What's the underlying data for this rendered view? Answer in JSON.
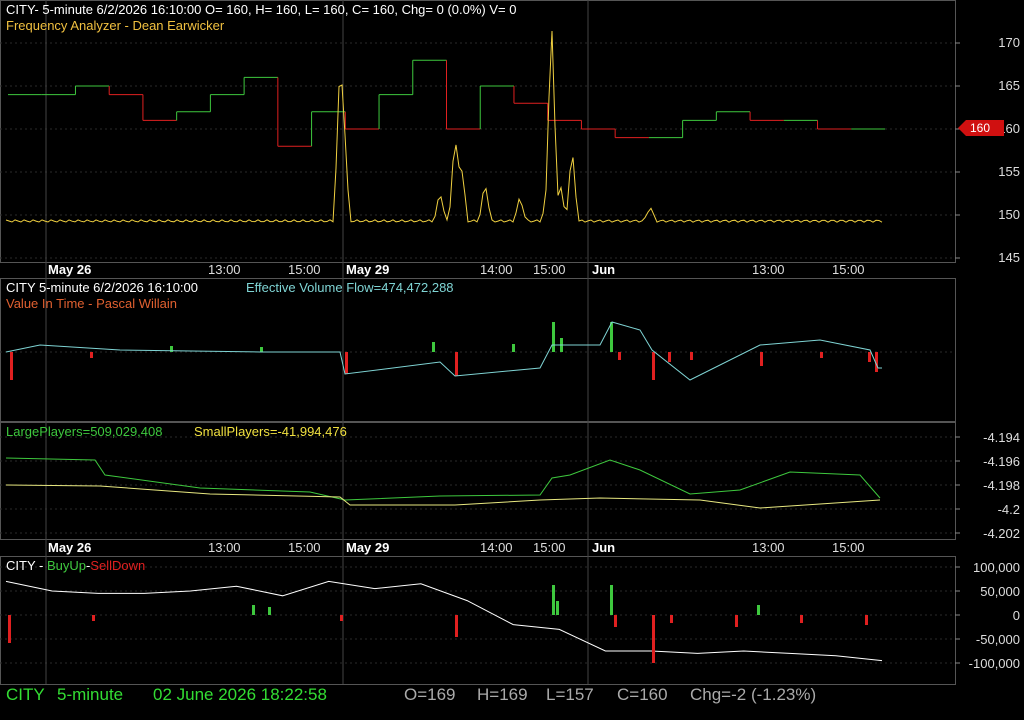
{
  "panel1": {
    "header": "CITY- 5-minute 6/2/2026 16:10:00 O= 160, H= 160, L= 160, C= 160, Chg= 0 (0.0%) V= 0",
    "subtitle": "Frequency Analyzer - Dean Earwicker",
    "yticks": [
      "170",
      "165",
      "160",
      "155",
      "150",
      "145"
    ],
    "price_tag": "160"
  },
  "panel2": {
    "header_left": "CITY 5-minute  6/2/2026 16:10:00",
    "header_right": "Effective Volume Flow=474,472,288",
    "subtitle": "Value In Time - Pascal Willain"
  },
  "panel3": {
    "label_large": "LargePlayers=509,029,408",
    "label_small": "SmallPlayers=-41,994,476",
    "yticks": [
      "-4.194",
      "-4.196",
      "-4.198",
      "-4.2",
      "-4.202"
    ]
  },
  "panel4": {
    "label_city": "CITY - ",
    "label_buy": "BuyUp",
    "label_dash": "-",
    "label_sell": "SellDown",
    "yticks": [
      "100,000",
      "50,000",
      "0",
      "-50,000",
      "-100,000"
    ]
  },
  "date_axis": {
    "labels": [
      {
        "text": "May 26",
        "major": true
      },
      {
        "text": "13:00",
        "major": false
      },
      {
        "text": "15:00",
        "major": false
      },
      {
        "text": "May 29",
        "major": true
      },
      {
        "text": "14:00",
        "major": false
      },
      {
        "text": "15:00",
        "major": false
      },
      {
        "text": "Jun",
        "major": true
      },
      {
        "text": "13:00",
        "major": false
      },
      {
        "text": "15:00",
        "major": false
      }
    ]
  },
  "status_bar": {
    "symbol": "CITY",
    "interval": "5-minute",
    "datetime": "02 June 2026 18:22:58",
    "open": "O=169",
    "high": "H=169",
    "low": "L=157",
    "close": "C=160",
    "change": "Chg=-2 (-1.23%)"
  },
  "colors": {
    "up": "#3ec83e",
    "down": "#e02020",
    "oscillator": "#f0d040",
    "flow": "#7fd4d4",
    "white": "#ffffff",
    "grid": "#2a2a2a",
    "status_green": "#33dd33"
  },
  "chart_data": [
    {
      "type": "line",
      "title": "Frequency Analyzer - Dean Earwicker",
      "x": [
        "May 26",
        "13:00",
        "15:00",
        "May 29",
        "14:00",
        "15:00",
        "Jun",
        "13:00",
        "15:00"
      ],
      "ylim": [
        145,
        170
      ],
      "series": [
        {
          "name": "CITY",
          "values": [
            164,
            164,
            165,
            164,
            161,
            162,
            164,
            166,
            158,
            162,
            160,
            164,
            168,
            160,
            165,
            163,
            161,
            160,
            159,
            159,
            161,
            162,
            161,
            161,
            160,
            160
          ]
        }
      ]
    },
    {
      "type": "line",
      "title": "Value In Time - Pascal Willain",
      "series": [
        {
          "name": "Effective Volume Flow",
          "values": [
            474472288
          ]
        }
      ]
    },
    {
      "type": "line",
      "ylim": [
        -4.202,
        -4.194
      ],
      "series": [
        {
          "name": "LargePlayers",
          "values": [
            509029408
          ]
        },
        {
          "name": "SmallPlayers",
          "values": [
            -41994476
          ]
        }
      ]
    },
    {
      "type": "bar",
      "title": "BuyUp-SellDown",
      "ylim": [
        -100000,
        100000
      ],
      "series": [
        {
          "name": "BuyUp-SellDown",
          "values": [
            70000,
            50000,
            45000,
            45000,
            50000,
            60000,
            40000,
            70000,
            55000,
            65000,
            30000,
            -20000,
            -30000,
            -75000,
            -75000,
            -80000,
            -75000,
            -80000,
            -85000,
            -95000
          ]
        }
      ]
    }
  ]
}
